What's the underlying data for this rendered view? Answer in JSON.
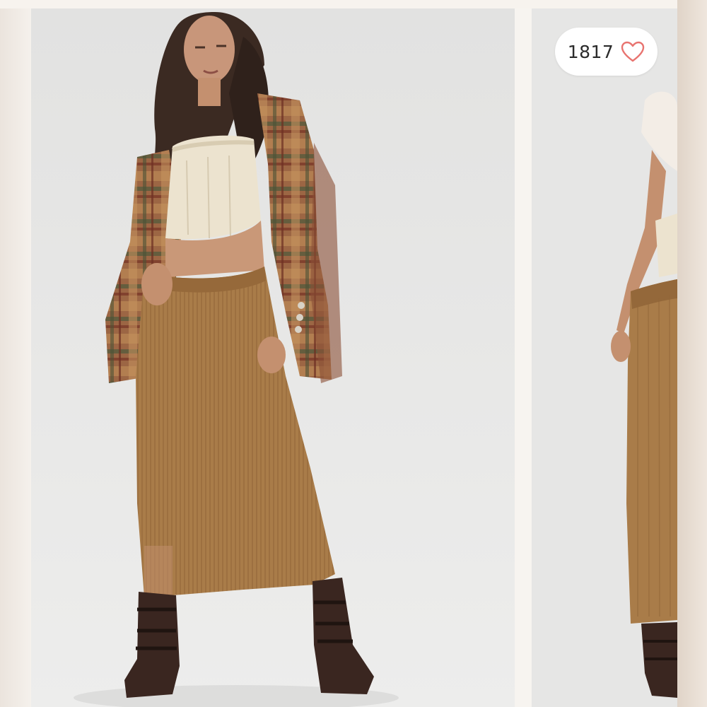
{
  "likes": {
    "count": "1817",
    "icon": "heart-outline-icon",
    "icon_color": "#e8736f"
  },
  "photos": [
    {
      "name": "model-photo-front",
      "active": true
    },
    {
      "name": "model-photo-back",
      "active": false
    }
  ],
  "colors": {
    "background": "#f5f1ec",
    "photo_backdrop": "#e7e7e6",
    "skirt": "#a87c48",
    "jacket_plaid": "#8c5a3c",
    "top": "#ece3cf",
    "boots": "#3a2620"
  }
}
